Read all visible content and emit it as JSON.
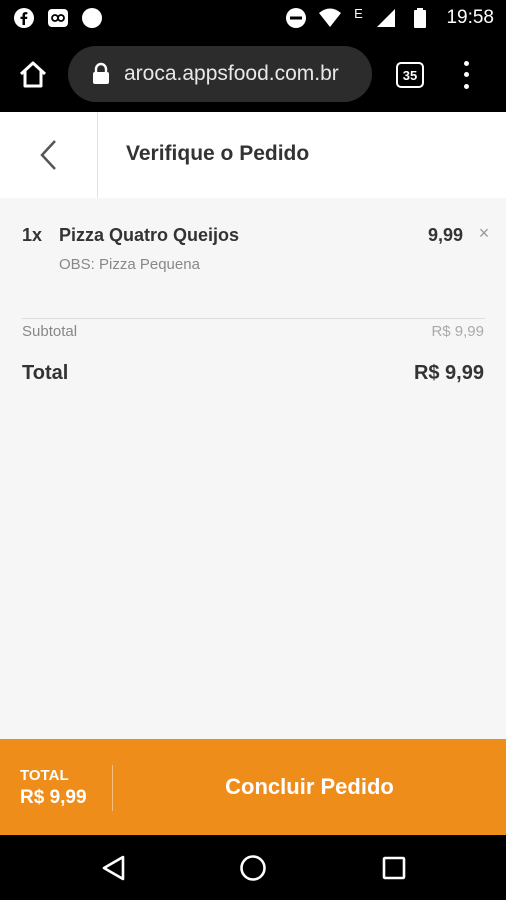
{
  "status_bar": {
    "time": "19:58",
    "network_label": "E",
    "icons_left": [
      "facebook-icon",
      "notification-icon",
      "circle-icon"
    ],
    "icons_right": [
      "do-not-disturb-icon",
      "wifi-icon",
      "signal-icon",
      "battery-icon"
    ]
  },
  "browser": {
    "url": "aroca.appsfood.com.br",
    "tab_count": "35"
  },
  "header": {
    "title": "Verifique o Pedido"
  },
  "order": {
    "items": [
      {
        "qty": "1x",
        "name": "Pizza Quatro Queijos",
        "obs": "OBS: Pizza Pequena",
        "price": "9,99",
        "remove": "×"
      }
    ],
    "subtotal_label": "Subtotal",
    "subtotal_value": "R$ 9,99",
    "total_label": "Total",
    "total_value": "R$ 9,99"
  },
  "bottom_bar": {
    "total_label": "TOTAL",
    "total_value": "R$ 9,99",
    "button_label": "Concluir Pedido",
    "accent_color": "#ef8d1b"
  },
  "nav_bar": {
    "buttons": [
      "back-icon",
      "home-icon",
      "recents-icon"
    ]
  }
}
